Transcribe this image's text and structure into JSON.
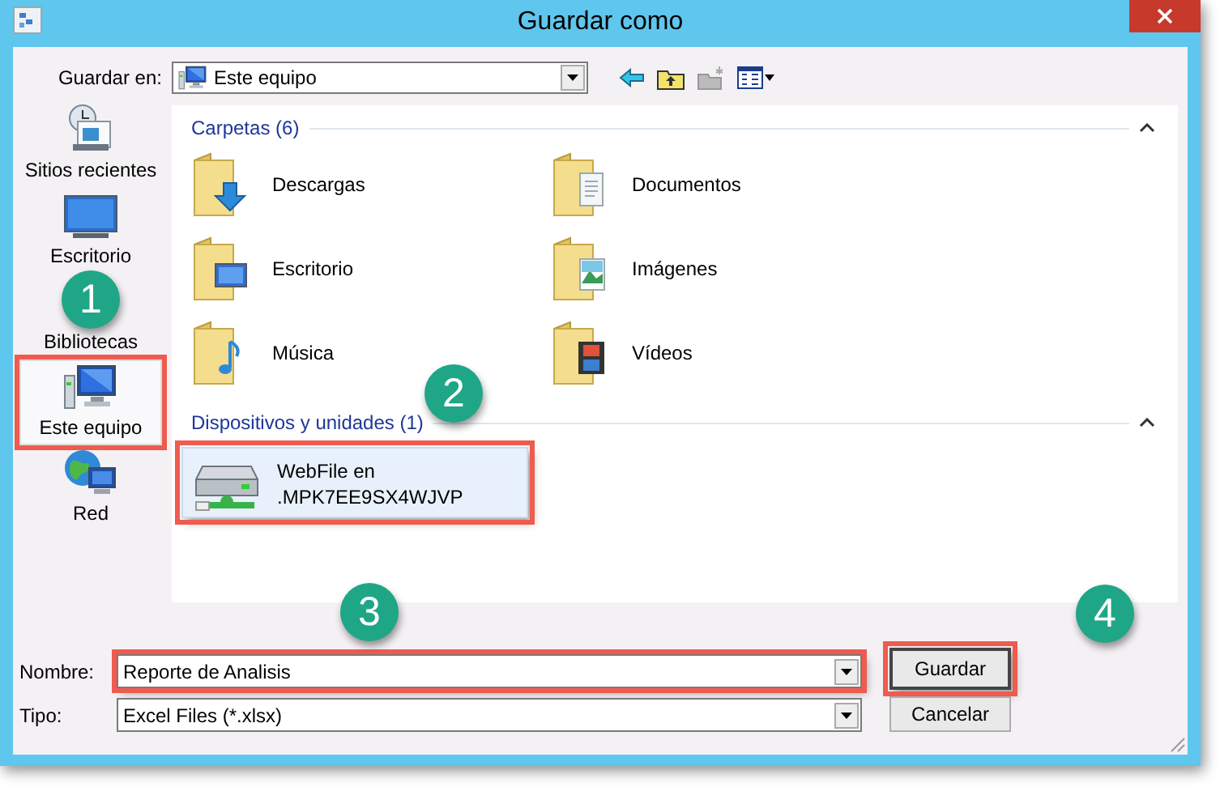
{
  "window": {
    "title": "Guardar como"
  },
  "toolbar": {
    "label": "Guardar en:",
    "location": "Este equipo"
  },
  "sidebar": {
    "items": [
      {
        "label": "Sitios recientes",
        "selected": false,
        "highlighted": false
      },
      {
        "label": "Escritorio",
        "selected": false,
        "highlighted": false
      },
      {
        "label": "Bibliotecas",
        "selected": false,
        "highlighted": false
      },
      {
        "label": "Este equipo",
        "selected": true,
        "highlighted": true
      },
      {
        "label": "Red",
        "selected": false,
        "highlighted": false
      }
    ]
  },
  "groups": [
    {
      "title": "Carpetas (6)",
      "expanded": true,
      "kind": "folders",
      "items": [
        {
          "label": "Descargas"
        },
        {
          "label": "Documentos"
        },
        {
          "label": "Escritorio"
        },
        {
          "label": "Imágenes"
        },
        {
          "label": "Música"
        },
        {
          "label": "Vídeos"
        }
      ]
    },
    {
      "title": "Dispositivos y unidades (1)",
      "expanded": true,
      "kind": "devices",
      "items": [
        {
          "name": "WebFile en",
          "path": ".MPK7EE9SX4WJVP",
          "selected": true,
          "highlighted": true
        }
      ]
    }
  ],
  "name_field": {
    "label": "Nombre:",
    "value": "Reporte de Analisis",
    "highlighted": true
  },
  "type_field": {
    "label": "Tipo:",
    "value": "Excel Files (*.xlsx)"
  },
  "buttons": [
    {
      "label": "Guardar",
      "default": true,
      "highlighted": true
    },
    {
      "label": "Cancelar",
      "default": false,
      "highlighted": false
    }
  ],
  "annotations": [
    {
      "number": "1"
    },
    {
      "number": "2"
    },
    {
      "number": "3"
    },
    {
      "number": "4"
    }
  ]
}
